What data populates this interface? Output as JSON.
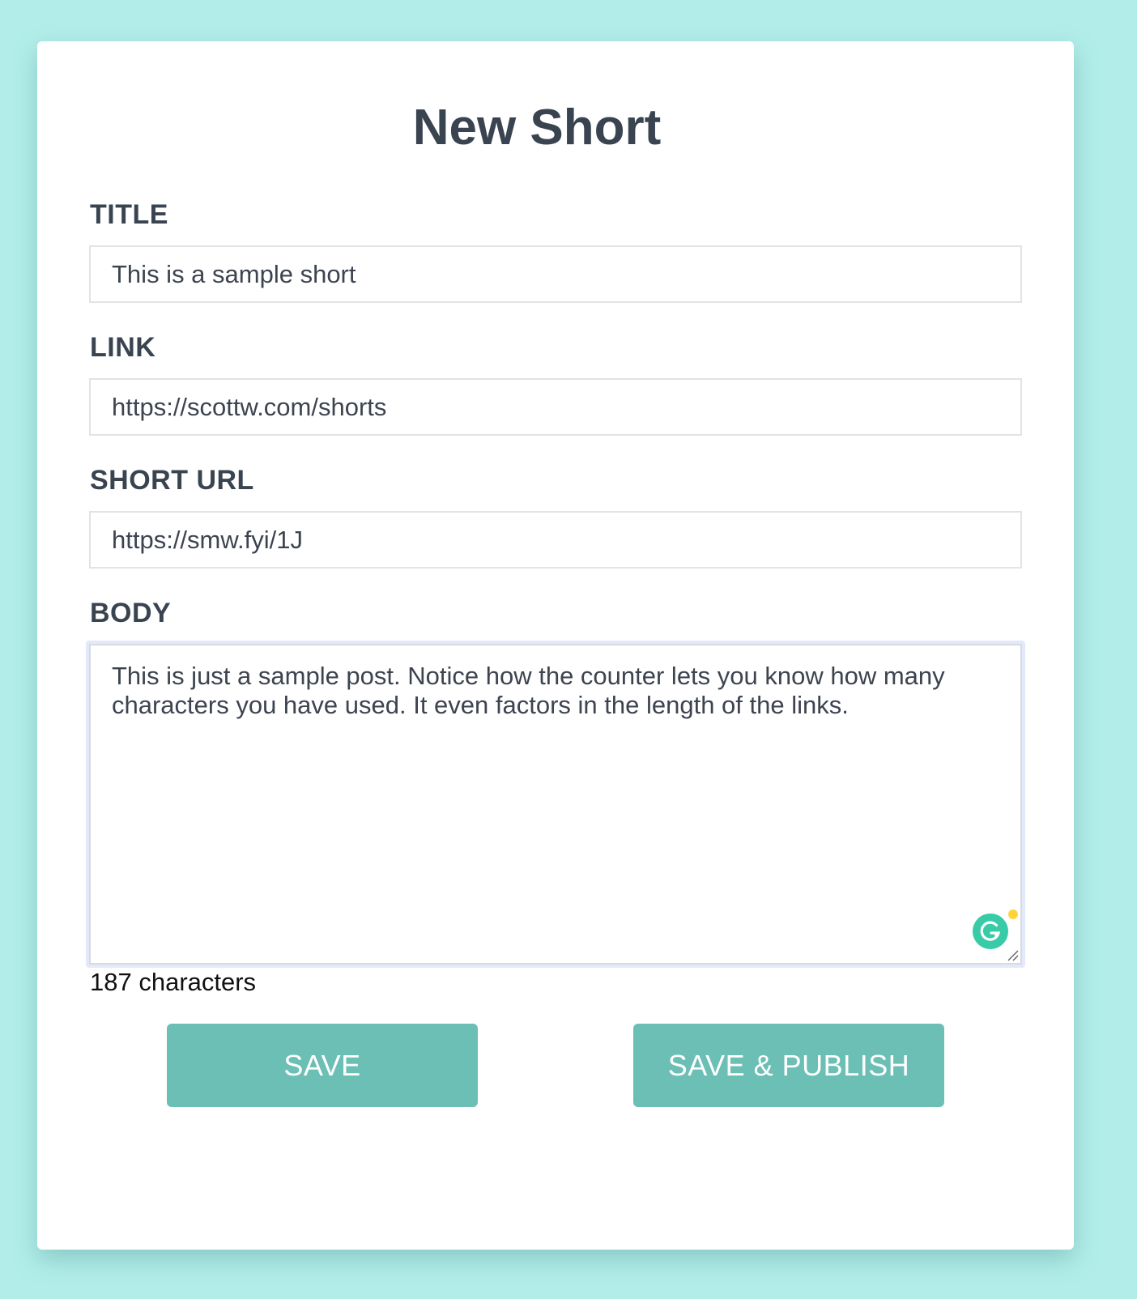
{
  "form": {
    "title": "New Short",
    "fields": {
      "title": {
        "label": "TITLE",
        "value": "This is a sample short"
      },
      "link": {
        "label": "LINK",
        "value": "https://scottw.com/shorts"
      },
      "short_url": {
        "label": "SHORT URL",
        "value": "https://smw.fyi/1J"
      },
      "body": {
        "label": "BODY",
        "value": "This is just a sample post. Notice how the counter lets you know how many characters you have used. It even factors in the length of the links."
      }
    },
    "char_count": "187 characters",
    "buttons": {
      "save": "SAVE",
      "save_publish": "SAVE & PUBLISH"
    }
  },
  "icons": {
    "grammarly": "grammarly-icon",
    "resize": "resize-handle-icon"
  },
  "colors": {
    "background": "#b2ede9",
    "card": "#ffffff",
    "button": "#6cbfb5",
    "text": "#3a4451",
    "focus_ring": "#e3e9fb",
    "grammarly_green": "#15c39a",
    "grammarly_dot": "#ffd43b"
  }
}
